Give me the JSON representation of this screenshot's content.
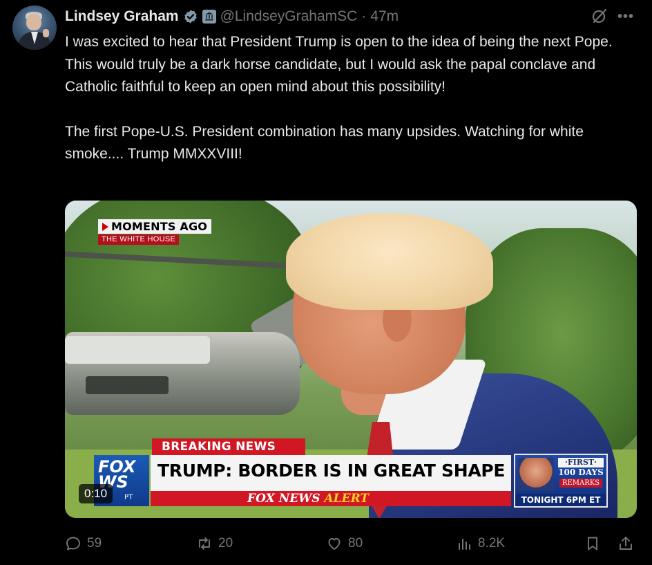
{
  "author": {
    "name": "Lindsey Graham",
    "handle": "@LindseyGrahamSC",
    "separator": "·",
    "time": "47m"
  },
  "tweet": {
    "paragraphs": [
      "I was excited to hear that President Trump is open to the idea of being the next Pope. This would truly be a dark horse candidate, but I would ask the papal conclave and Catholic faithful to keep an open mind about this possibility!",
      "The first Pope-U.S. President combination has many upsides. Watching for white smoke.... Trump MMXXVIII!"
    ]
  },
  "video": {
    "moments_badge": "MOMENTS AGO",
    "location_badge": "THE WHITE HOUSE",
    "breaking_label_1": "BREAKING",
    "breaking_label_2": "NEWS",
    "headline": "TRUMP: BORDER IS IN GREAT SHAPE",
    "alert_brand": "FOX NEWS",
    "alert_word": "ALERT",
    "logo_text": "FOX",
    "logo_line2": "WS",
    "logo_sub": "PT",
    "promo_first": "·FIRST·",
    "promo_days": "100 DAYS",
    "promo_remarks": "REMARKS",
    "promo_tonight": "TONIGHT 6PM ET",
    "duration": "0:10"
  },
  "actions": {
    "replies": "59",
    "reposts": "20",
    "likes": "80",
    "views": "8.2K"
  },
  "colors": {
    "background": "#000000",
    "text": "#e7e9ea",
    "muted": "#71767b",
    "verified": "#829aab",
    "fox_red": "#d11624",
    "fox_blue": "#10398a"
  },
  "icons": [
    "avatar",
    "verified-badge-icon",
    "government-building-icon",
    "grok-icon",
    "more-icon",
    "reply-icon",
    "repost-icon",
    "like-icon",
    "views-icon",
    "bookmark-icon",
    "share-icon"
  ]
}
